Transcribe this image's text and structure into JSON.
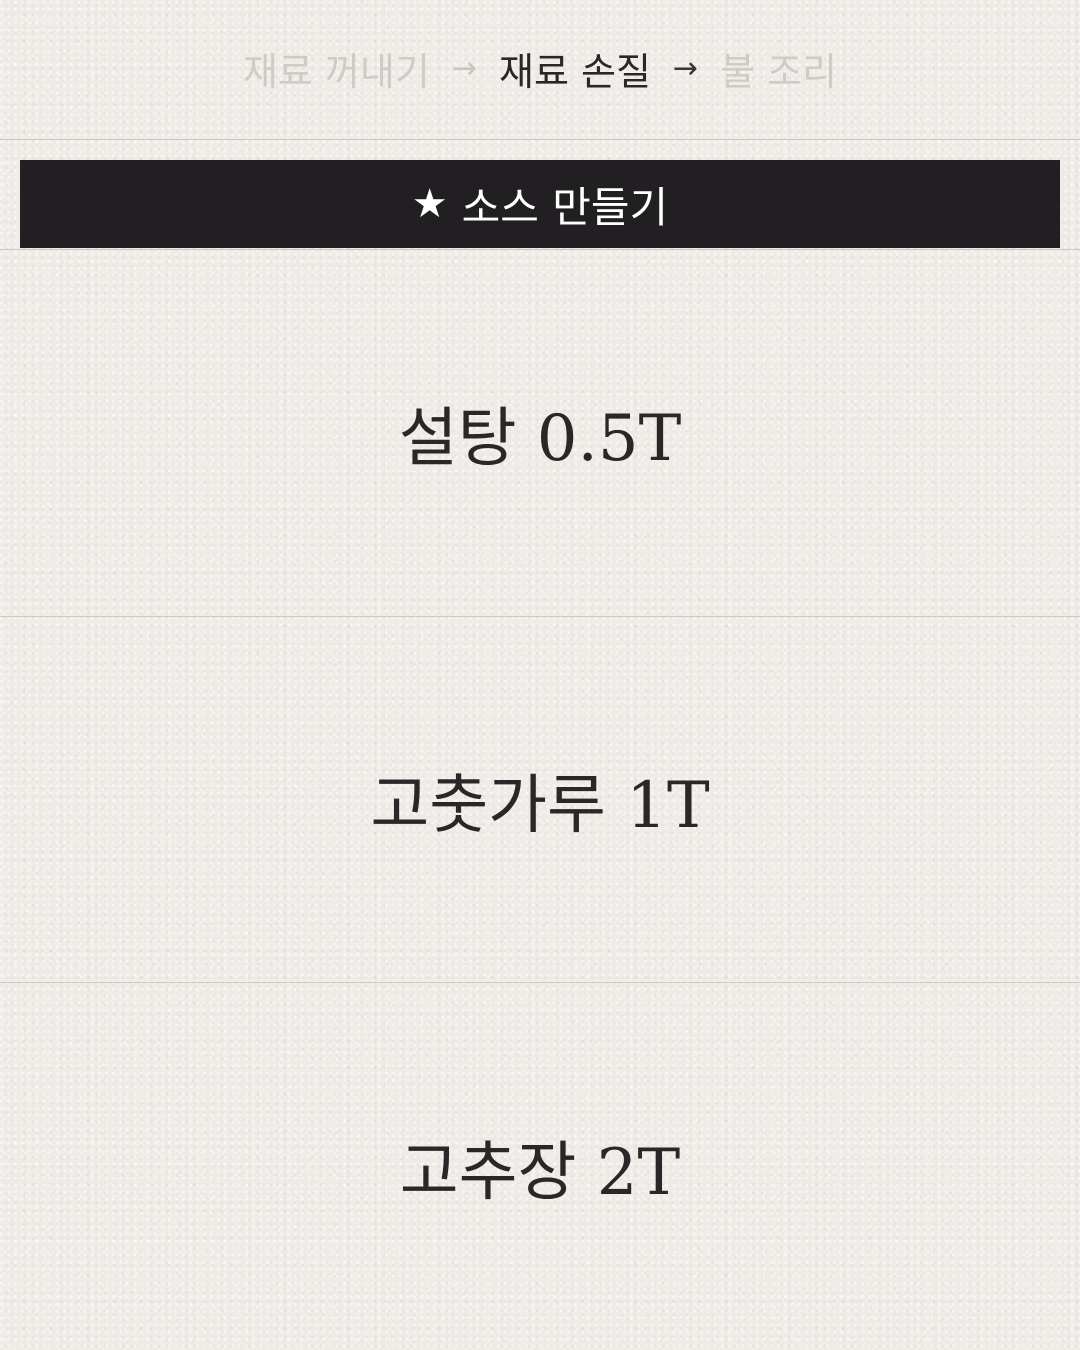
{
  "progress": {
    "steps": [
      {
        "label": "재료 꺼내기",
        "state": "done"
      },
      {
        "label": "재료 손질",
        "state": "current"
      },
      {
        "label": "불 조리",
        "state": "todo"
      }
    ],
    "arrow": "→"
  },
  "section": {
    "icon": "star-icon",
    "star": "★",
    "title": "소스 만들기"
  },
  "ingredients": [
    {
      "text": "설탕 0.5T"
    },
    {
      "text": "고춧가루 1T"
    },
    {
      "text": "고추장 2T"
    }
  ],
  "colors": {
    "background": "#efebe6",
    "banner": "#221f22",
    "text": "#2a2729",
    "muted": "#cfcbc6"
  }
}
